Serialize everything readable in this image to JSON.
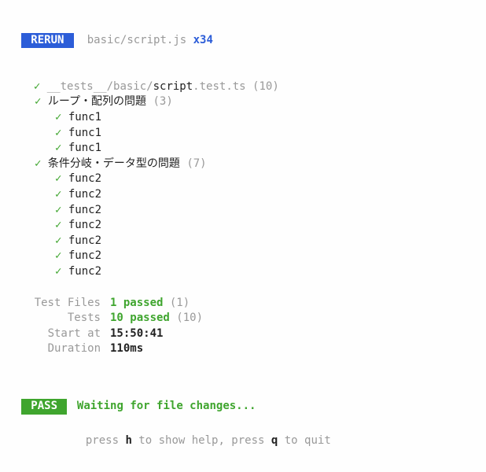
{
  "header": {
    "badge": "RERUN",
    "path": "basic/script.js",
    "multiplier": "x34"
  },
  "file": {
    "prefix": "__tests__/basic/",
    "name": "script",
    "suffix": ".test.ts",
    "count": "(10)"
  },
  "suites": [
    {
      "title": "ループ・配列の問題",
      "count": "(3)",
      "tests": [
        "func1",
        "func1",
        "func1"
      ]
    },
    {
      "title": "条件分岐・データ型の問題",
      "count": "(7)",
      "tests": [
        "func2",
        "func2",
        "func2",
        "func2",
        "func2",
        "func2",
        "func2"
      ]
    }
  ],
  "summary": {
    "rows": [
      {
        "label": "Test Files",
        "strong": "1 passed",
        "rest": " (1)"
      },
      {
        "label": "Tests",
        "strong": "10 passed",
        "rest": " (10)"
      },
      {
        "label": "Start at",
        "value": "15:50:41"
      },
      {
        "label": "Duration",
        "value": "110ms"
      }
    ]
  },
  "status": {
    "badge": "PASS",
    "message": "Waiting for file changes...",
    "help_pre1": "press ",
    "help_key1": "h",
    "help_mid": " to show help, press ",
    "help_key2": "q",
    "help_post": " to quit"
  },
  "glyph": {
    "tick": "✓"
  }
}
